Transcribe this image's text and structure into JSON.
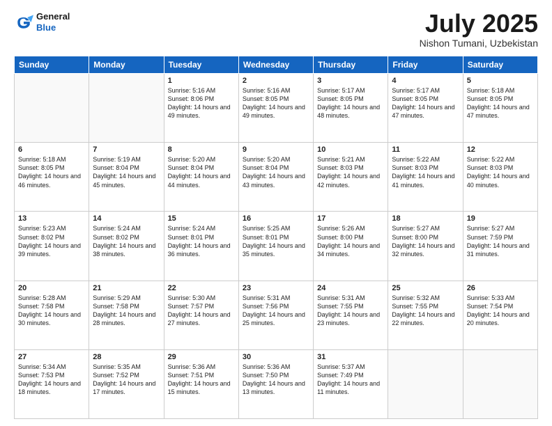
{
  "header": {
    "logo_line1": "General",
    "logo_line2": "Blue",
    "month": "July 2025",
    "location": "Nishon Tumani, Uzbekistan"
  },
  "days_of_week": [
    "Sunday",
    "Monday",
    "Tuesday",
    "Wednesday",
    "Thursday",
    "Friday",
    "Saturday"
  ],
  "weeks": [
    [
      {
        "day": "",
        "sunrise": "",
        "sunset": "",
        "daylight": ""
      },
      {
        "day": "",
        "sunrise": "",
        "sunset": "",
        "daylight": ""
      },
      {
        "day": "1",
        "sunrise": "Sunrise: 5:16 AM",
        "sunset": "Sunset: 8:06 PM",
        "daylight": "Daylight: 14 hours and 49 minutes."
      },
      {
        "day": "2",
        "sunrise": "Sunrise: 5:16 AM",
        "sunset": "Sunset: 8:05 PM",
        "daylight": "Daylight: 14 hours and 49 minutes."
      },
      {
        "day": "3",
        "sunrise": "Sunrise: 5:17 AM",
        "sunset": "Sunset: 8:05 PM",
        "daylight": "Daylight: 14 hours and 48 minutes."
      },
      {
        "day": "4",
        "sunrise": "Sunrise: 5:17 AM",
        "sunset": "Sunset: 8:05 PM",
        "daylight": "Daylight: 14 hours and 47 minutes."
      },
      {
        "day": "5",
        "sunrise": "Sunrise: 5:18 AM",
        "sunset": "Sunset: 8:05 PM",
        "daylight": "Daylight: 14 hours and 47 minutes."
      }
    ],
    [
      {
        "day": "6",
        "sunrise": "Sunrise: 5:18 AM",
        "sunset": "Sunset: 8:05 PM",
        "daylight": "Daylight: 14 hours and 46 minutes."
      },
      {
        "day": "7",
        "sunrise": "Sunrise: 5:19 AM",
        "sunset": "Sunset: 8:04 PM",
        "daylight": "Daylight: 14 hours and 45 minutes."
      },
      {
        "day": "8",
        "sunrise": "Sunrise: 5:20 AM",
        "sunset": "Sunset: 8:04 PM",
        "daylight": "Daylight: 14 hours and 44 minutes."
      },
      {
        "day": "9",
        "sunrise": "Sunrise: 5:20 AM",
        "sunset": "Sunset: 8:04 PM",
        "daylight": "Daylight: 14 hours and 43 minutes."
      },
      {
        "day": "10",
        "sunrise": "Sunrise: 5:21 AM",
        "sunset": "Sunset: 8:03 PM",
        "daylight": "Daylight: 14 hours and 42 minutes."
      },
      {
        "day": "11",
        "sunrise": "Sunrise: 5:22 AM",
        "sunset": "Sunset: 8:03 PM",
        "daylight": "Daylight: 14 hours and 41 minutes."
      },
      {
        "day": "12",
        "sunrise": "Sunrise: 5:22 AM",
        "sunset": "Sunset: 8:03 PM",
        "daylight": "Daylight: 14 hours and 40 minutes."
      }
    ],
    [
      {
        "day": "13",
        "sunrise": "Sunrise: 5:23 AM",
        "sunset": "Sunset: 8:02 PM",
        "daylight": "Daylight: 14 hours and 39 minutes."
      },
      {
        "day": "14",
        "sunrise": "Sunrise: 5:24 AM",
        "sunset": "Sunset: 8:02 PM",
        "daylight": "Daylight: 14 hours and 38 minutes."
      },
      {
        "day": "15",
        "sunrise": "Sunrise: 5:24 AM",
        "sunset": "Sunset: 8:01 PM",
        "daylight": "Daylight: 14 hours and 36 minutes."
      },
      {
        "day": "16",
        "sunrise": "Sunrise: 5:25 AM",
        "sunset": "Sunset: 8:01 PM",
        "daylight": "Daylight: 14 hours and 35 minutes."
      },
      {
        "day": "17",
        "sunrise": "Sunrise: 5:26 AM",
        "sunset": "Sunset: 8:00 PM",
        "daylight": "Daylight: 14 hours and 34 minutes."
      },
      {
        "day": "18",
        "sunrise": "Sunrise: 5:27 AM",
        "sunset": "Sunset: 8:00 PM",
        "daylight": "Daylight: 14 hours and 32 minutes."
      },
      {
        "day": "19",
        "sunrise": "Sunrise: 5:27 AM",
        "sunset": "Sunset: 7:59 PM",
        "daylight": "Daylight: 14 hours and 31 minutes."
      }
    ],
    [
      {
        "day": "20",
        "sunrise": "Sunrise: 5:28 AM",
        "sunset": "Sunset: 7:58 PM",
        "daylight": "Daylight: 14 hours and 30 minutes."
      },
      {
        "day": "21",
        "sunrise": "Sunrise: 5:29 AM",
        "sunset": "Sunset: 7:58 PM",
        "daylight": "Daylight: 14 hours and 28 minutes."
      },
      {
        "day": "22",
        "sunrise": "Sunrise: 5:30 AM",
        "sunset": "Sunset: 7:57 PM",
        "daylight": "Daylight: 14 hours and 27 minutes."
      },
      {
        "day": "23",
        "sunrise": "Sunrise: 5:31 AM",
        "sunset": "Sunset: 7:56 PM",
        "daylight": "Daylight: 14 hours and 25 minutes."
      },
      {
        "day": "24",
        "sunrise": "Sunrise: 5:31 AM",
        "sunset": "Sunset: 7:55 PM",
        "daylight": "Daylight: 14 hours and 23 minutes."
      },
      {
        "day": "25",
        "sunrise": "Sunrise: 5:32 AM",
        "sunset": "Sunset: 7:55 PM",
        "daylight": "Daylight: 14 hours and 22 minutes."
      },
      {
        "day": "26",
        "sunrise": "Sunrise: 5:33 AM",
        "sunset": "Sunset: 7:54 PM",
        "daylight": "Daylight: 14 hours and 20 minutes."
      }
    ],
    [
      {
        "day": "27",
        "sunrise": "Sunrise: 5:34 AM",
        "sunset": "Sunset: 7:53 PM",
        "daylight": "Daylight: 14 hours and 18 minutes."
      },
      {
        "day": "28",
        "sunrise": "Sunrise: 5:35 AM",
        "sunset": "Sunset: 7:52 PM",
        "daylight": "Daylight: 14 hours and 17 minutes."
      },
      {
        "day": "29",
        "sunrise": "Sunrise: 5:36 AM",
        "sunset": "Sunset: 7:51 PM",
        "daylight": "Daylight: 14 hours and 15 minutes."
      },
      {
        "day": "30",
        "sunrise": "Sunrise: 5:36 AM",
        "sunset": "Sunset: 7:50 PM",
        "daylight": "Daylight: 14 hours and 13 minutes."
      },
      {
        "day": "31",
        "sunrise": "Sunrise: 5:37 AM",
        "sunset": "Sunset: 7:49 PM",
        "daylight": "Daylight: 14 hours and 11 minutes."
      },
      {
        "day": "",
        "sunrise": "",
        "sunset": "",
        "daylight": ""
      },
      {
        "day": "",
        "sunrise": "",
        "sunset": "",
        "daylight": ""
      }
    ]
  ]
}
